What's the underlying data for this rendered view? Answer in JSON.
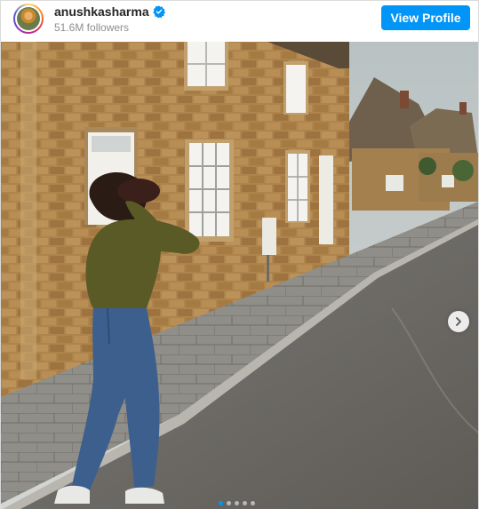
{
  "header": {
    "username": "anushkasharma",
    "followers": "51.6M followers",
    "view_profile_label": "View Profile"
  },
  "icons": {
    "verified": "verified-badge-icon",
    "next": "chevron-right-icon"
  },
  "colors": {
    "accent": "#0095f6",
    "username": "#262626",
    "secondary_text": "#8e8e8e"
  },
  "carousel": {
    "slide_count": 5,
    "active_index": 0
  }
}
